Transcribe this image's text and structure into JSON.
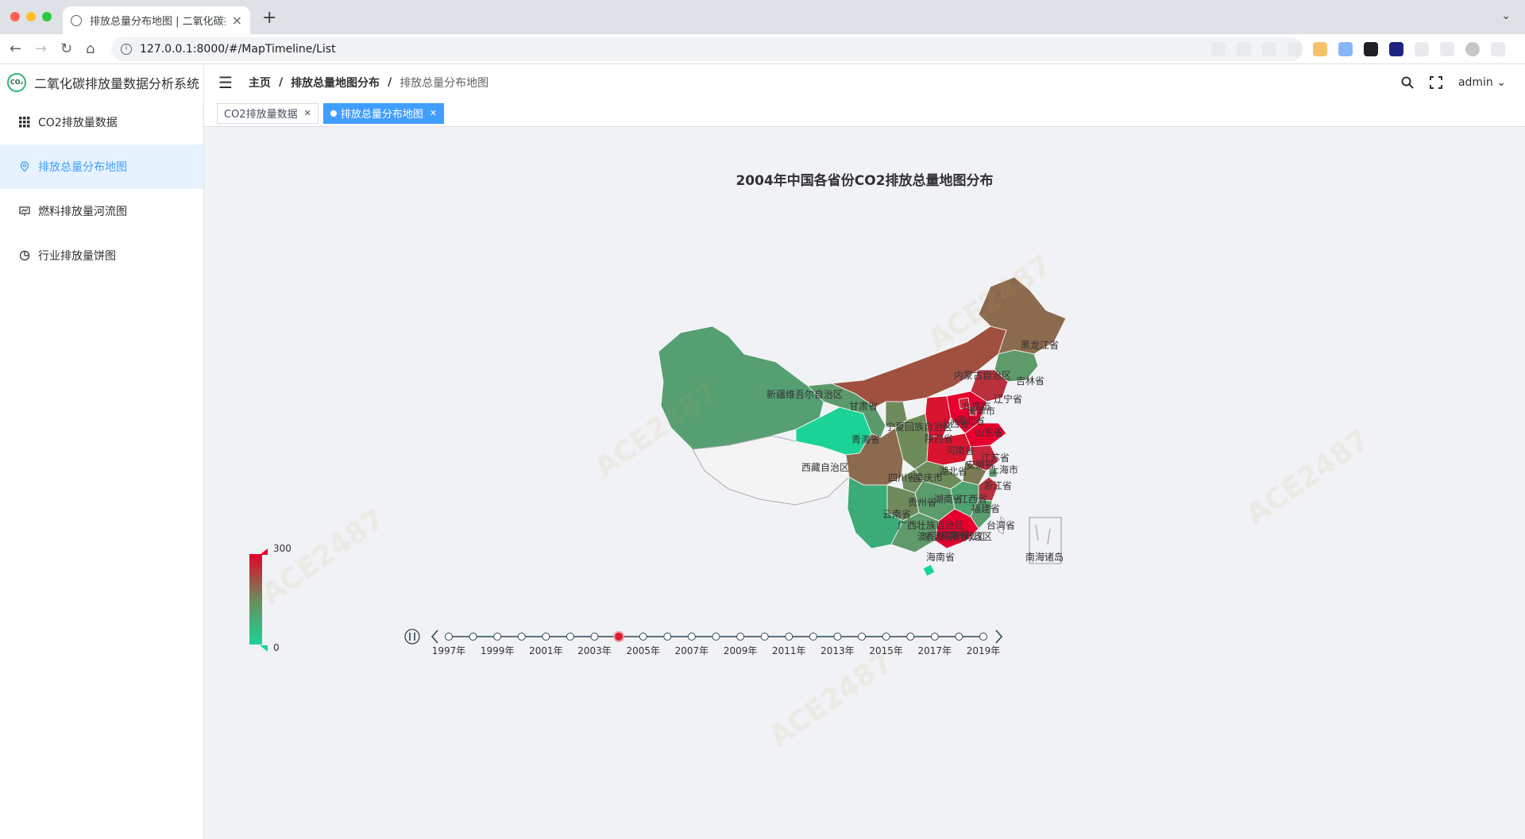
{
  "browser": {
    "tab_title": "排放总量分布地图 | 二氧化碳排放",
    "url": "127.0.0.1:8000/#/MapTimeline/List"
  },
  "app": {
    "title": "二氧化碳排放量数据分析系统",
    "logo_text": "CO₂"
  },
  "sidebar": {
    "items": [
      {
        "label": "CO2排放量数据",
        "icon": "grid-icon",
        "active": false
      },
      {
        "label": "排放总量分布地图",
        "icon": "map-pin-icon",
        "active": true
      },
      {
        "label": "燃料排放量河流图",
        "icon": "chart-icon",
        "active": false
      },
      {
        "label": "行业排放量饼图",
        "icon": "pie-icon",
        "active": false
      }
    ]
  },
  "header": {
    "breadcrumb": [
      "主页",
      "排放总量地图分布",
      "排放总量分布地图"
    ],
    "user": "admin"
  },
  "tags": [
    {
      "label": "CO2排放量数据",
      "active": false
    },
    {
      "label": "排放总量分布地图",
      "active": true
    }
  ],
  "chart_data": {
    "type": "map",
    "title": "2004年中国各省份CO2排放总量地图分布",
    "visual_map": {
      "min": 0,
      "max": 300,
      "max_label": "300",
      "min_label": "0",
      "color_low": "#1bd397",
      "color_mid": "#6b8c5a",
      "color_high": "#e6002e"
    },
    "provinces": [
      {
        "name": "黑龙江省"
      },
      {
        "name": "吉林省"
      },
      {
        "name": "辽宁省"
      },
      {
        "name": "内蒙古自治区"
      },
      {
        "name": "新疆维吾尔自治区"
      },
      {
        "name": "甘肃省"
      },
      {
        "name": "宁夏回族自治区"
      },
      {
        "name": "山西省"
      },
      {
        "name": "北京市"
      },
      {
        "name": "天津市"
      },
      {
        "name": "河北省"
      },
      {
        "name": "山东省"
      },
      {
        "name": "青海省"
      },
      {
        "name": "陕西省"
      },
      {
        "name": "河南省"
      },
      {
        "name": "江苏省"
      },
      {
        "name": "西藏自治区"
      },
      {
        "name": "四川省"
      },
      {
        "name": "重庆市"
      },
      {
        "name": "湖北省"
      },
      {
        "name": "安徽省"
      },
      {
        "name": "上海市"
      },
      {
        "name": "浙江省"
      },
      {
        "name": "贵州省"
      },
      {
        "name": "湖南省"
      },
      {
        "name": "江西省"
      },
      {
        "name": "福建省"
      },
      {
        "name": "云南省"
      },
      {
        "name": "广西壮族自治区"
      },
      {
        "name": "广东省"
      },
      {
        "name": "香港特别行政区"
      },
      {
        "name": "澳门特别行政区"
      },
      {
        "name": "台湾省"
      },
      {
        "name": "海南省"
      },
      {
        "name": "南海诸岛"
      }
    ],
    "timeline": {
      "years": [
        "1997年",
        "1998年",
        "1999年",
        "2000年",
        "2001年",
        "2002年",
        "2003年",
        "2004年",
        "2005年",
        "2006年",
        "2007年",
        "2008年",
        "2009年",
        "2010年",
        "2011年",
        "2012年",
        "2013年",
        "2014年",
        "2015年",
        "2016年",
        "2017年",
        "2018年",
        "2019年"
      ],
      "shown_labels": [
        "1997年",
        "1999年",
        "2001年",
        "2003年",
        "2005年",
        "2007年",
        "2009年",
        "2011年",
        "2013年",
        "2015年",
        "2017年",
        "2019年"
      ],
      "current": "2004年"
    }
  },
  "colors": {
    "accent": "#409eff",
    "active_menu_bg": "#e6f2ff"
  }
}
